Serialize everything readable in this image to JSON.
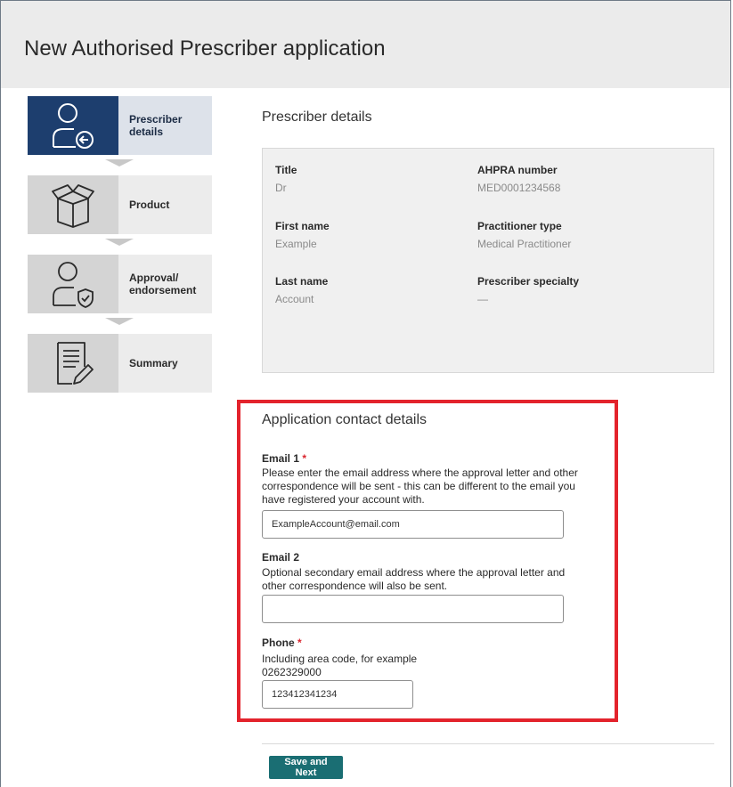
{
  "page": {
    "title": "New Authorised Prescriber application"
  },
  "stepper": [
    {
      "label": "Prescriber\ndetails",
      "icon": "person-arrow-icon",
      "active": true
    },
    {
      "label": "Product",
      "icon": "box-icon",
      "active": false
    },
    {
      "label": "Approval/\nendorsement",
      "icon": "person-shield-icon",
      "active": false
    },
    {
      "label": "Summary",
      "icon": "document-pen-icon",
      "active": false
    }
  ],
  "prescriber": {
    "heading": "Prescriber details",
    "title_label": "Title",
    "title_value": "Dr",
    "ahpra_label": "AHPRA number",
    "ahpra_value": "MED0001234568",
    "first_label": "First name",
    "first_value": "Example",
    "type_label": "Practitioner type",
    "type_value": "Medical Practitioner",
    "last_label": "Last name",
    "last_value": "Account",
    "specialty_label": "Prescriber specialty",
    "specialty_value": "—"
  },
  "contact": {
    "heading": "Application contact details",
    "email1_label": "Email 1",
    "email1_help": "Please enter the email address where the approval letter and other correspondence will be sent - this can be different to the email you have registered your account with.",
    "email1_value": "ExampleAccount@email.com",
    "email2_label": "Email 2",
    "email2_help": "Optional secondary email address where the approval letter and other correspondence will also be sent.",
    "email2_value": "",
    "phone_label": "Phone",
    "phone_help_1": "Including area code, for example",
    "phone_help_2": "0262329000",
    "phone_value": "123412341234",
    "required_mark": "*"
  },
  "actions": {
    "save_next": "Save and Next"
  },
  "colors": {
    "active_step": "#1d3e6e",
    "highlight": "#e3232c",
    "button": "#1a6e73",
    "required": "#d9252e"
  }
}
